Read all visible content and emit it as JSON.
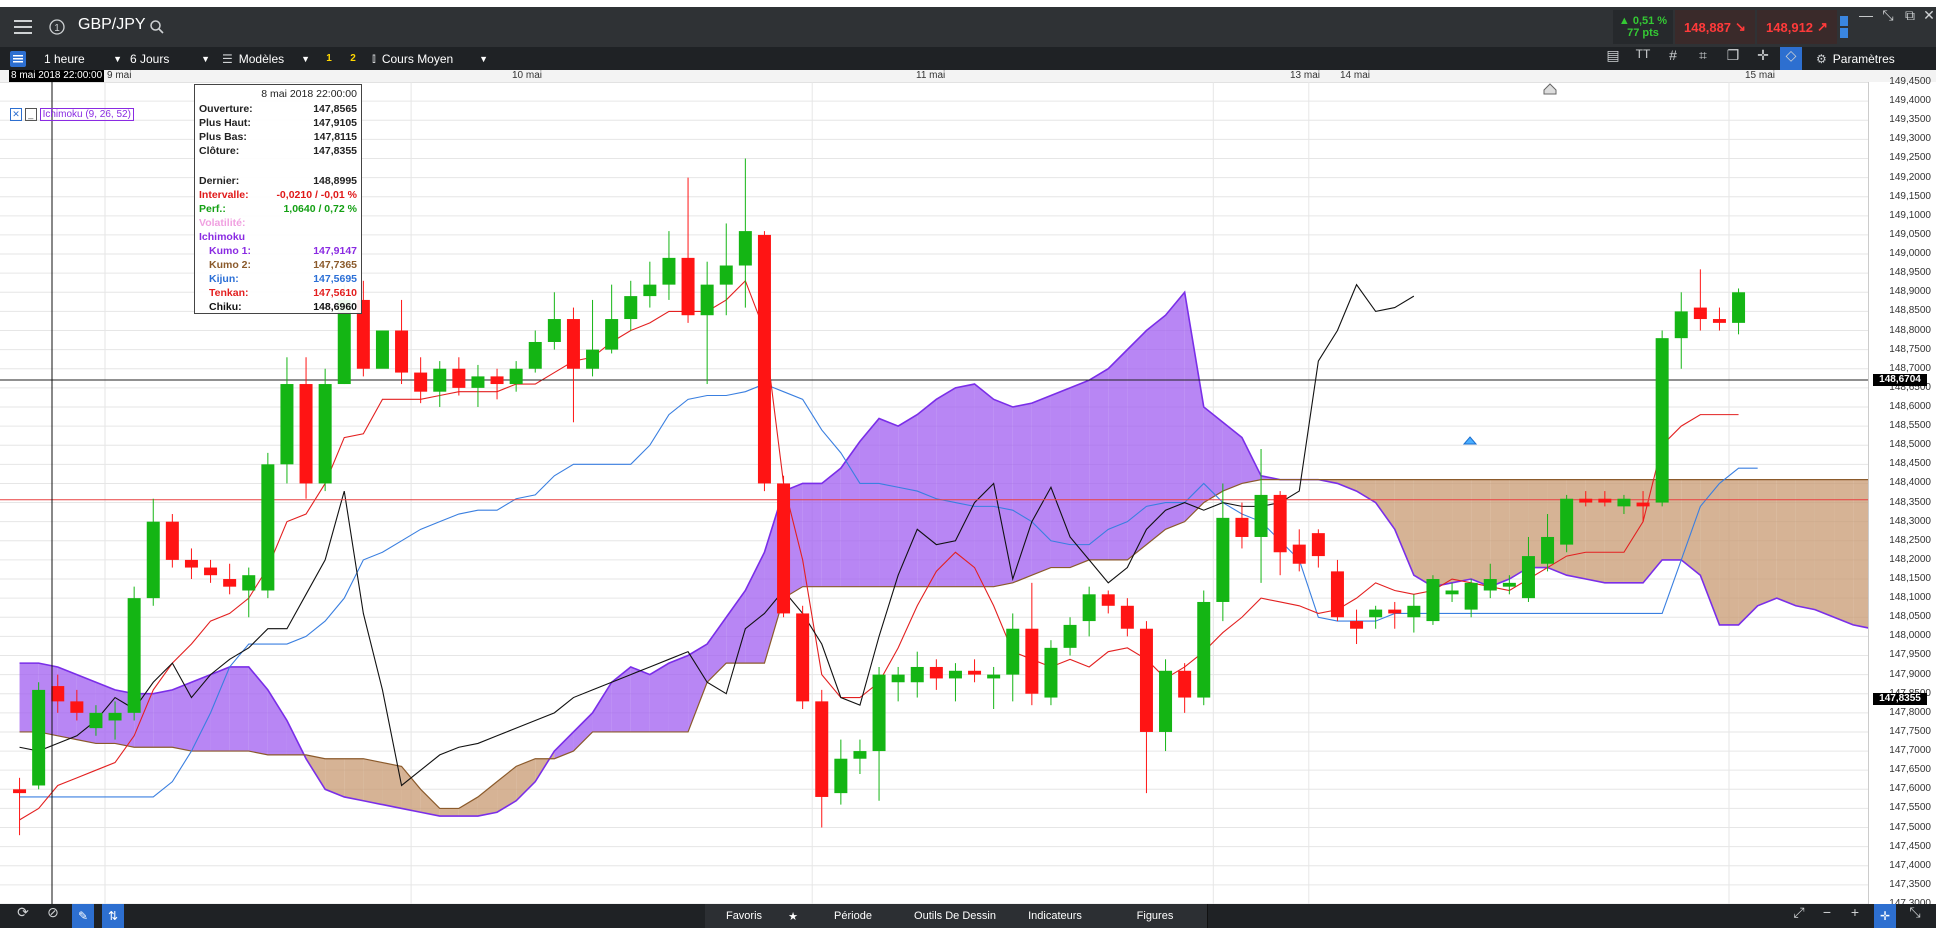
{
  "topbar": {
    "symbol": "GBP/JPY",
    "change_pct": "▲ 0,51 %",
    "change_pts": "77 pts",
    "sell_price": "148,887",
    "buy_price": "148,912",
    "colors": {
      "up": "#34c934",
      "sell": "#ff3a3a",
      "buy": "#ff3a3a"
    }
  },
  "toolbar": {
    "interval": "1 heure",
    "range": "6 Jours",
    "templates": "Modèles",
    "slot1": "1",
    "slot2": "2",
    "price_type": "Cours Moyen",
    "settings": "Paramètres"
  },
  "datebar": {
    "cursor_date": "8 mai 2018 22:00:00",
    "dates": [
      "9 mai",
      "10 mai",
      "11 mai",
      "13 mai",
      "14 mai",
      "15 mai"
    ]
  },
  "indicator_tag": "Ichimoku (9, 26, 52)",
  "tooltip": {
    "date": "8 mai 2018 22:00:00",
    "rows": [
      {
        "k": "Ouverture:",
        "v": "147,8565"
      },
      {
        "k": "Plus Haut:",
        "v": "147,9105"
      },
      {
        "k": "Plus Bas:",
        "v": "147,8115"
      },
      {
        "k": "Clôture:",
        "v": "147,8355"
      },
      {
        "k": "Dernier:",
        "v": "148,8995"
      },
      {
        "k": "Intervalle:",
        "v": "-0,0210 / -0,01 %"
      },
      {
        "k": "Perf.:",
        "v": "1,0640 / 0,72 %"
      },
      {
        "k": "Volatilité:",
        "v": ""
      },
      {
        "k": "Ichimoku",
        "v": ""
      },
      {
        "k": "Kumo 1:",
        "v": "147,9147"
      },
      {
        "k": "Kumo 2:",
        "v": "147,7365"
      },
      {
        "k": "Kijun:",
        "v": "147,5695"
      },
      {
        "k": "Tenkan:",
        "v": "147,5610"
      },
      {
        "k": "Chiku:",
        "v": "148,6960"
      }
    ]
  },
  "price_axis": {
    "ticks": [
      "149,4500",
      "149,4000",
      "149,3500",
      "149,3000",
      "149,2500",
      "149,2000",
      "149,1500",
      "149,1000",
      "149,0500",
      "149,0000",
      "148,9500",
      "148,9000",
      "148,8500",
      "148,8000",
      "148,7500",
      "148,7000",
      "148,6500",
      "148,6000",
      "148,5500",
      "148,5000",
      "148,4500",
      "148,4000",
      "148,3500",
      "148,3000",
      "148,2500",
      "148,2000",
      "148,1500",
      "148,1000",
      "148,0500",
      "148,0000",
      "147,9500",
      "147,9000",
      "147,8500",
      "147,8000",
      "147,7500",
      "147,7000",
      "147,6500",
      "147,6000",
      "147,5500",
      "147,5000",
      "147,4500",
      "147,4000",
      "147,3500",
      "147,3000"
    ],
    "current_label": "148,6704",
    "cursor_label": "147,8355"
  },
  "bottombar": {
    "tabs": [
      "Favoris",
      "Période",
      "Outils De Dessin",
      "Indicateurs",
      "Figures"
    ]
  },
  "chart_data": {
    "type": "candlestick",
    "title": "",
    "ylim": [
      147.3,
      149.45
    ],
    "n_slots": 100,
    "candles": [
      {
        "o": 147.6,
        "h": 147.63,
        "l": 147.48,
        "c": 147.59
      },
      {
        "o": 147.61,
        "h": 147.88,
        "l": 147.6,
        "c": 147.86
      },
      {
        "o": 147.87,
        "h": 147.9,
        "l": 147.8,
        "c": 147.83
      },
      {
        "o": 147.83,
        "h": 147.86,
        "l": 147.78,
        "c": 147.8
      },
      {
        "o": 147.76,
        "h": 147.82,
        "l": 147.74,
        "c": 147.8
      },
      {
        "o": 147.78,
        "h": 147.83,
        "l": 147.73,
        "c": 147.8
      },
      {
        "o": 147.8,
        "h": 148.13,
        "l": 147.78,
        "c": 148.1
      },
      {
        "o": 148.1,
        "h": 148.36,
        "l": 148.08,
        "c": 148.3
      },
      {
        "o": 148.3,
        "h": 148.32,
        "l": 148.18,
        "c": 148.2
      },
      {
        "o": 148.2,
        "h": 148.23,
        "l": 148.15,
        "c": 148.18
      },
      {
        "o": 148.18,
        "h": 148.2,
        "l": 148.14,
        "c": 148.16
      },
      {
        "o": 148.15,
        "h": 148.19,
        "l": 148.11,
        "c": 148.13
      },
      {
        "o": 148.12,
        "h": 148.18,
        "l": 148.05,
        "c": 148.16
      },
      {
        "o": 148.12,
        "h": 148.48,
        "l": 148.1,
        "c": 148.45
      },
      {
        "o": 148.45,
        "h": 148.73,
        "l": 148.4,
        "c": 148.66
      },
      {
        "o": 148.66,
        "h": 148.73,
        "l": 148.36,
        "c": 148.4
      },
      {
        "o": 148.4,
        "h": 148.7,
        "l": 148.38,
        "c": 148.66
      },
      {
        "o": 148.66,
        "h": 148.92,
        "l": 148.66,
        "c": 148.88
      },
      {
        "o": 148.88,
        "h": 148.93,
        "l": 148.68,
        "c": 148.7
      },
      {
        "o": 148.7,
        "h": 148.8,
        "l": 148.72,
        "c": 148.8
      },
      {
        "o": 148.8,
        "h": 148.88,
        "l": 148.66,
        "c": 148.69
      },
      {
        "o": 148.69,
        "h": 148.73,
        "l": 148.61,
        "c": 148.64
      },
      {
        "o": 148.64,
        "h": 148.72,
        "l": 148.6,
        "c": 148.7
      },
      {
        "o": 148.7,
        "h": 148.73,
        "l": 148.63,
        "c": 148.65
      },
      {
        "o": 148.65,
        "h": 148.71,
        "l": 148.6,
        "c": 148.68
      },
      {
        "o": 148.68,
        "h": 148.7,
        "l": 148.62,
        "c": 148.66
      },
      {
        "o": 148.66,
        "h": 148.72,
        "l": 148.64,
        "c": 148.7
      },
      {
        "o": 148.7,
        "h": 148.8,
        "l": 148.69,
        "c": 148.77
      },
      {
        "o": 148.77,
        "h": 148.9,
        "l": 148.75,
        "c": 148.83
      },
      {
        "o": 148.83,
        "h": 148.86,
        "l": 148.56,
        "c": 148.7
      },
      {
        "o": 148.7,
        "h": 148.88,
        "l": 148.68,
        "c": 148.75
      },
      {
        "o": 148.75,
        "h": 148.92,
        "l": 148.74,
        "c": 148.83
      },
      {
        "o": 148.83,
        "h": 148.93,
        "l": 148.8,
        "c": 148.89
      },
      {
        "o": 148.89,
        "h": 148.98,
        "l": 148.86,
        "c": 148.92
      },
      {
        "o": 148.92,
        "h": 149.06,
        "l": 148.88,
        "c": 148.99
      },
      {
        "o": 148.99,
        "h": 149.2,
        "l": 148.82,
        "c": 148.84
      },
      {
        "o": 148.84,
        "h": 148.98,
        "l": 148.66,
        "c": 148.92
      },
      {
        "o": 148.92,
        "h": 149.08,
        "l": 148.84,
        "c": 148.97
      },
      {
        "o": 148.97,
        "h": 149.25,
        "l": 148.86,
        "c": 149.06
      },
      {
        "o": 149.05,
        "h": 149.06,
        "l": 148.38,
        "c": 148.4
      },
      {
        "o": 148.4,
        "h": 148.42,
        "l": 148.05,
        "c": 148.06
      },
      {
        "o": 148.06,
        "h": 148.08,
        "l": 147.81,
        "c": 147.83
      },
      {
        "o": 147.83,
        "h": 147.86,
        "l": 147.5,
        "c": 147.58
      },
      {
        "o": 147.59,
        "h": 147.73,
        "l": 147.56,
        "c": 147.68
      },
      {
        "o": 147.68,
        "h": 147.73,
        "l": 147.64,
        "c": 147.7
      },
      {
        "o": 147.7,
        "h": 147.92,
        "l": 147.57,
        "c": 147.9
      },
      {
        "o": 147.88,
        "h": 147.92,
        "l": 147.83,
        "c": 147.9
      },
      {
        "o": 147.88,
        "h": 147.96,
        "l": 147.84,
        "c": 147.92
      },
      {
        "o": 147.92,
        "h": 147.94,
        "l": 147.86,
        "c": 147.89
      },
      {
        "o": 147.89,
        "h": 147.93,
        "l": 147.83,
        "c": 147.91
      },
      {
        "o": 147.91,
        "h": 147.94,
        "l": 147.88,
        "c": 147.9
      },
      {
        "o": 147.89,
        "h": 147.92,
        "l": 147.81,
        "c": 147.9
      },
      {
        "o": 147.9,
        "h": 148.06,
        "l": 147.83,
        "c": 148.02
      },
      {
        "o": 148.02,
        "h": 148.14,
        "l": 147.82,
        "c": 147.85
      },
      {
        "o": 147.84,
        "h": 147.99,
        "l": 147.82,
        "c": 147.97
      },
      {
        "o": 147.97,
        "h": 148.05,
        "l": 147.95,
        "c": 148.03
      },
      {
        "o": 148.04,
        "h": 148.13,
        "l": 148.0,
        "c": 148.11
      },
      {
        "o": 148.11,
        "h": 148.12,
        "l": 148.06,
        "c": 148.08
      },
      {
        "o": 148.08,
        "h": 148.1,
        "l": 148.0,
        "c": 148.02
      },
      {
        "o": 148.02,
        "h": 148.04,
        "l": 147.59,
        "c": 147.75
      },
      {
        "o": 147.75,
        "h": 147.94,
        "l": 147.7,
        "c": 147.91
      },
      {
        "o": 147.91,
        "h": 147.93,
        "l": 147.8,
        "c": 147.84
      },
      {
        "o": 147.84,
        "h": 148.12,
        "l": 147.82,
        "c": 148.09
      },
      {
        "o": 148.09,
        "h": 148.4,
        "l": 148.04,
        "c": 148.31
      },
      {
        "o": 148.31,
        "h": 148.35,
        "l": 148.23,
        "c": 148.26
      },
      {
        "o": 148.26,
        "h": 148.49,
        "l": 148.14,
        "c": 148.37
      },
      {
        "o": 148.37,
        "h": 148.38,
        "l": 148.16,
        "c": 148.22
      },
      {
        "o": 148.24,
        "h": 148.28,
        "l": 148.17,
        "c": 148.19
      },
      {
        "o": 148.27,
        "h": 148.28,
        "l": 148.18,
        "c": 148.21
      },
      {
        "o": 148.17,
        "h": 148.2,
        "l": 148.04,
        "c": 148.05
      },
      {
        "o": 148.04,
        "h": 148.07,
        "l": 147.98,
        "c": 148.02
      },
      {
        "o": 148.05,
        "h": 148.08,
        "l": 148.02,
        "c": 148.07
      },
      {
        "o": 148.07,
        "h": 148.09,
        "l": 148.02,
        "c": 148.06
      },
      {
        "o": 148.05,
        "h": 148.11,
        "l": 148.01,
        "c": 148.08
      },
      {
        "o": 148.04,
        "h": 148.16,
        "l": 148.03,
        "c": 148.15
      },
      {
        "o": 148.11,
        "h": 148.14,
        "l": 148.09,
        "c": 148.12
      },
      {
        "o": 148.07,
        "h": 148.15,
        "l": 148.05,
        "c": 148.14
      },
      {
        "o": 148.12,
        "h": 148.19,
        "l": 148.1,
        "c": 148.15
      },
      {
        "o": 148.13,
        "h": 148.16,
        "l": 148.11,
        "c": 148.14
      },
      {
        "o": 148.1,
        "h": 148.26,
        "l": 148.09,
        "c": 148.21
      },
      {
        "o": 148.19,
        "h": 148.32,
        "l": 148.17,
        "c": 148.26
      },
      {
        "o": 148.24,
        "h": 148.37,
        "l": 148.22,
        "c": 148.36
      },
      {
        "o": 148.36,
        "h": 148.38,
        "l": 148.34,
        "c": 148.35
      },
      {
        "o": 148.36,
        "h": 148.38,
        "l": 148.34,
        "c": 148.35
      },
      {
        "o": 148.34,
        "h": 148.37,
        "l": 148.32,
        "c": 148.36
      },
      {
        "o": 148.35,
        "h": 148.38,
        "l": 148.3,
        "c": 148.34
      },
      {
        "o": 148.35,
        "h": 148.8,
        "l": 148.34,
        "c": 148.78
      },
      {
        "o": 148.78,
        "h": 148.9,
        "l": 148.7,
        "c": 148.85
      },
      {
        "o": 148.86,
        "h": 148.96,
        "l": 148.8,
        "c": 148.83
      },
      {
        "o": 148.83,
        "h": 148.86,
        "l": 148.8,
        "c": 148.82
      },
      {
        "o": 148.82,
        "h": 148.91,
        "l": 148.79,
        "c": 148.9
      }
    ],
    "tenkan": [
      147.52,
      147.55,
      147.61,
      147.63,
      147.65,
      147.67,
      147.74,
      147.86,
      147.93,
      147.98,
      148.04,
      148.06,
      148.1,
      148.18,
      148.3,
      148.32,
      148.4,
      148.52,
      148.53,
      148.62,
      148.62,
      148.62,
      148.63,
      148.64,
      148.64,
      148.64,
      148.66,
      148.66,
      148.69,
      148.72,
      148.73,
      148.77,
      148.8,
      148.82,
      148.85,
      148.85,
      148.85,
      148.88,
      148.93,
      148.8,
      148.4,
      148.2,
      147.9,
      147.84,
      147.84,
      147.88,
      147.97,
      148.08,
      148.17,
      148.22,
      148.18,
      148.08,
      147.96,
      147.94,
      147.92,
      147.94,
      147.92,
      147.96,
      147.97,
      147.94,
      147.89,
      147.92,
      147.96,
      148.01,
      148.05,
      148.1,
      148.09,
      148.08,
      148.06,
      148.07,
      148.1,
      148.14,
      148.12,
      148.11,
      148.12,
      148.15,
      148.14,
      148.13,
      148.12,
      148.15,
      148.18,
      148.21,
      148.22,
      148.22,
      148.22,
      148.3,
      148.5,
      148.55,
      148.58,
      148.58,
      148.58
    ],
    "kijun": [
      147.58,
      147.58,
      147.58,
      147.58,
      147.58,
      147.58,
      147.58,
      147.58,
      147.62,
      147.7,
      147.8,
      147.92,
      147.98,
      147.98,
      147.98,
      148.0,
      148.04,
      148.1,
      148.2,
      148.22,
      148.25,
      148.28,
      148.3,
      148.32,
      148.33,
      148.33,
      148.36,
      148.37,
      148.42,
      148.45,
      148.45,
      148.45,
      148.45,
      148.5,
      148.58,
      148.62,
      148.63,
      148.63,
      148.64,
      148.66,
      148.64,
      148.62,
      148.54,
      148.48,
      148.4,
      148.4,
      148.39,
      148.38,
      148.36,
      148.35,
      148.34,
      148.34,
      148.33,
      148.3,
      148.25,
      148.24,
      148.24,
      148.28,
      148.3,
      148.34,
      148.35,
      148.35,
      148.4,
      148.35,
      148.32,
      148.3,
      148.25,
      148.2,
      148.05,
      148.04,
      148.04,
      148.04,
      148.06,
      148.06,
      148.06,
      148.06,
      148.06,
      148.06,
      148.06,
      148.06,
      148.06,
      148.06,
      148.06,
      148.06,
      148.06,
      148.06,
      148.06,
      148.2,
      148.34,
      148.4,
      148.44,
      148.44
    ],
    "chikou": [
      147.71,
      147.7,
      147.72,
      147.74,
      147.78,
      147.84,
      147.81,
      147.88,
      147.93,
      147.84,
      147.9,
      147.94,
      147.97,
      148.02,
      148.02,
      148.11,
      148.2,
      148.38,
      148.06,
      147.86,
      147.61,
      147.65,
      147.69,
      147.71,
      147.72,
      147.74,
      147.76,
      147.78,
      147.8,
      147.84,
      147.86,
      147.88,
      147.9,
      147.92,
      147.94,
      147.96,
      147.88,
      147.85,
      148.02,
      148.06,
      148.12,
      148.06,
      147.98,
      147.84,
      147.82,
      148.0,
      148.16,
      148.28,
      148.24,
      148.25,
      148.35,
      148.4,
      148.15,
      148.3,
      148.39,
      148.26,
      148.2,
      148.14,
      148.18,
      148.28,
      148.33,
      148.35,
      148.33,
      148.35,
      148.34,
      148.34,
      148.35,
      148.38,
      148.72,
      148.8,
      148.92,
      148.85,
      148.86,
      148.89
    ],
    "kumo1": [
      147.93,
      147.93,
      147.92,
      147.9,
      147.88,
      147.86,
      147.85,
      147.85,
      147.86,
      147.88,
      147.9,
      147.92,
      147.92,
      147.86,
      147.78,
      147.68,
      147.6,
      147.58,
      147.57,
      147.56,
      147.55,
      147.54,
      147.53,
      147.53,
      147.53,
      147.54,
      147.57,
      147.62,
      147.7,
      147.75,
      147.8,
      147.88,
      147.92,
      147.9,
      147.93,
      147.95,
      147.98,
      148.05,
      148.12,
      148.22,
      148.38,
      148.4,
      148.4,
      148.44,
      148.51,
      148.57,
      148.55,
      148.58,
      148.62,
      148.65,
      148.66,
      148.62,
      148.6,
      148.61,
      148.63,
      148.65,
      148.67,
      148.7,
      148.75,
      148.8,
      148.84,
      148.9,
      148.6,
      148.56,
      148.52,
      148.42,
      148.41,
      148.41,
      148.41,
      148.4,
      148.38,
      148.35,
      148.28,
      148.16,
      148.13,
      148.14,
      148.15,
      148.13,
      148.15,
      148.18,
      148.18,
      148.16,
      148.15,
      148.14,
      148.14,
      148.14,
      148.2,
      148.2,
      148.16,
      148.03,
      148.03,
      148.08,
      148.1,
      148.08,
      148.07,
      148.05,
      148.03,
      148.02,
      148.05,
      148.08,
      148.09,
      148.1,
      148.11
    ],
    "kumo2": [
      147.75,
      147.75,
      147.74,
      147.73,
      147.72,
      147.72,
      147.71,
      147.71,
      147.71,
      147.7,
      147.7,
      147.7,
      147.7,
      147.69,
      147.69,
      147.69,
      147.68,
      147.68,
      147.68,
      147.67,
      147.66,
      147.6,
      147.55,
      147.55,
      147.58,
      147.62,
      147.66,
      147.68,
      147.68,
      147.7,
      147.75,
      147.75,
      147.75,
      147.75,
      147.75,
      147.75,
      147.88,
      147.93,
      147.93,
      147.93,
      148.1,
      148.13,
      148.13,
      148.13,
      148.13,
      148.13,
      148.13,
      148.13,
      148.13,
      148.13,
      148.13,
      148.13,
      148.14,
      148.16,
      148.18,
      148.18,
      148.2,
      148.2,
      148.2,
      148.24,
      148.28,
      148.3,
      148.35,
      148.38,
      148.4,
      148.41,
      148.41,
      148.41,
      148.41,
      148.41,
      148.41,
      148.41,
      148.41,
      148.41,
      148.41,
      148.41,
      148.41,
      148.41,
      148.41,
      148.41,
      148.41,
      148.41,
      148.41,
      148.41,
      148.41,
      148.41,
      148.41,
      148.41,
      148.41,
      148.41,
      148.41,
      148.41,
      148.41,
      148.41,
      148.41,
      148.41,
      148.41,
      148.41,
      148.41,
      148.41,
      148.41,
      148.41,
      148.41
    ],
    "hlines": [
      148.6704,
      148.3574
    ],
    "colors": {
      "up": "#14b514",
      "down": "#ff1414",
      "tenkan": "#e32020",
      "kijun": "#3a7fe0",
      "chikou": "#111111",
      "kumo_bull": "#a05ef0",
      "kumo_bear": "#c89a72",
      "kumo_line": "#7a2ee8",
      "kumo2_line": "#8b5a2b"
    }
  }
}
